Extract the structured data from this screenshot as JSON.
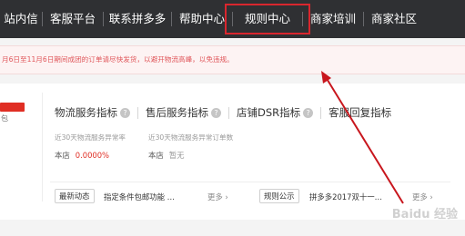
{
  "nav": {
    "items": [
      {
        "label": "站内信"
      },
      {
        "label": "客服平台"
      },
      {
        "label": "联系拼多多"
      },
      {
        "label": "帮助中心"
      },
      {
        "label": "规则中心"
      },
      {
        "label": "商家培训"
      },
      {
        "label": "商家社区"
      }
    ],
    "highlighted_index": 4
  },
  "notice": {
    "text": "月6日至11月6日期间成团的订单请尽快发货，以避开物流高峰，以免违规。"
  },
  "store": {
    "snippet": "包"
  },
  "tabs": [
    {
      "label": "物流服务指标"
    },
    {
      "label": "售后服务指标"
    },
    {
      "label": "店铺DSR指标"
    },
    {
      "label": "客服回复指标"
    }
  ],
  "metrics": [
    {
      "desc": "近30天物流服务异常率",
      "row_label": "本店",
      "value": "0.0000%"
    },
    {
      "desc": "近30天物流服务异常订单数",
      "row_label": "本店",
      "value": "暂无"
    }
  ],
  "latest": {
    "button": "最新动态",
    "text": "指定条件包邮功能 …",
    "more": "更多 ›"
  },
  "rules": {
    "button": "规则公示",
    "text": "拼多多2017双十一…",
    "more": "更多 ›"
  },
  "colors": {
    "nav_bg": "#2f3033",
    "highlight_box": "#d9262e",
    "notice_text": "#e0565a",
    "accent_red": "#e02e24"
  },
  "watermark": "Baidu 经验"
}
